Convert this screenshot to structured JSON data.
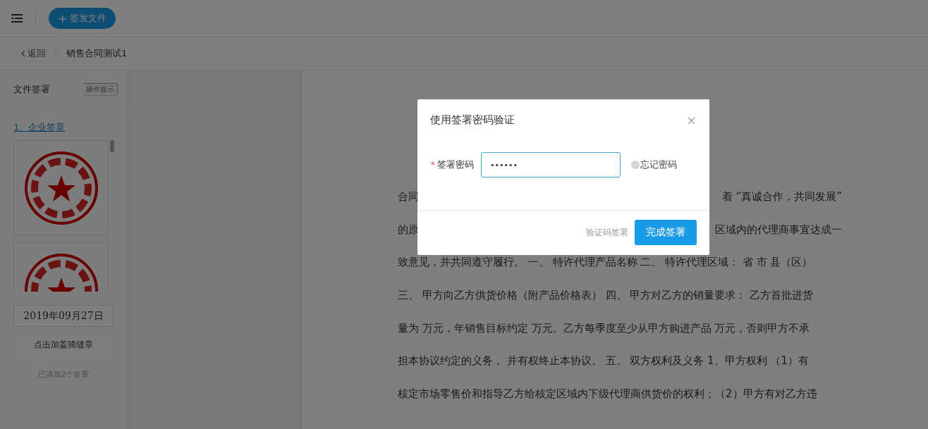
{
  "topbar": {
    "new_button": {
      "icon": "+",
      "label": "签发文件"
    }
  },
  "breadcrumb": {
    "back": "返回",
    "title": "销售合同测试1"
  },
  "sidebar": {
    "title": "文件签署",
    "hint_button": "操作提示",
    "section": "1、企业签章",
    "seals": [
      {
        "kind": "seal"
      },
      {
        "kind": "seal"
      }
    ],
    "date": "2019年09月27日",
    "seam_button": "点击加盖骑缝章",
    "count": "已添加2个签章"
  },
  "document": {
    "lines": [
      {
        "segments": [
          "合同",
          "着 “真诚合作，共同发展”"
        ]
      },
      {
        "segments": [
          "的原",
          "区域内的代理商事宜达成一"
        ]
      },
      {
        "segments": [
          "致意见，并共同遵守履行。 一、 特许代理产品名称 二、 特许代理区域： 省 市 县（区）"
        ]
      },
      {
        "segments": [
          "三、 甲方向乙方供货价格（附产品价格表） 四、 甲方对乙方的销量要求： 乙方首批进货"
        ]
      },
      {
        "segments": [
          "量为 万元，年销售目标约定 万元。乙方每季度至少从甲方购进产品 万元，否则甲方不承"
        ]
      },
      {
        "segments": [
          "担本协议约定的义务， 并有权终止本协议。 五、 双方权利及义务 1、甲方权利 （1）有"
        ]
      },
      {
        "segments": [
          "核定市场零售价和指导乙方给核定区域内下级代理商供货价的权利；（2）甲方有对乙方违"
        ]
      }
    ]
  },
  "dialog": {
    "title": "使用签署密码验证",
    "close": "×",
    "field": {
      "required_mark": "*",
      "label": "签署密码",
      "value": "••••••"
    },
    "forgot": "忘记密码",
    "secondary": "验证码签署",
    "primary": "完成签署"
  }
}
